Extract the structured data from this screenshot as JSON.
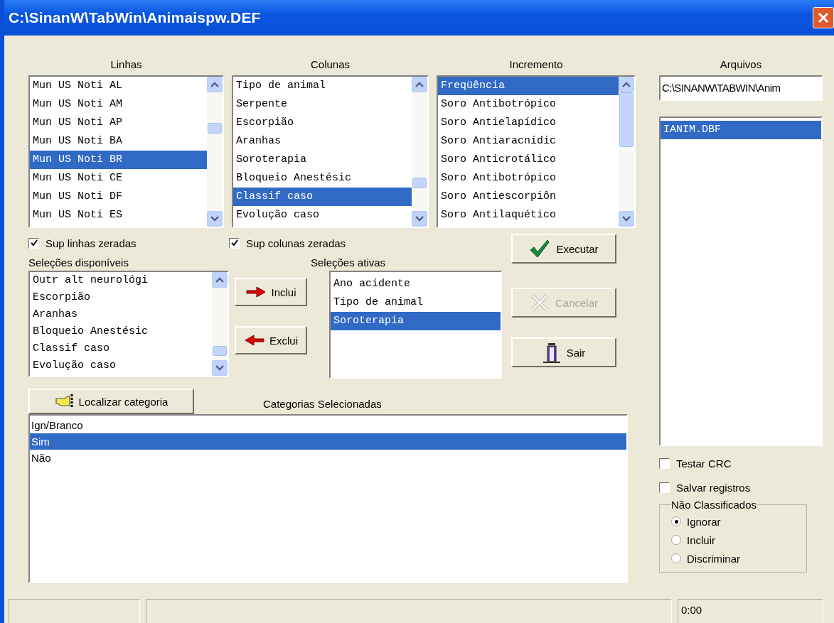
{
  "window": {
    "title": "C:\\SinanW\\TabWin\\Animaispw.DEF"
  },
  "top_lists": [
    {
      "label": "Linhas",
      "items": [
        {
          "text": "Mun US Noti AL",
          "selected": false
        },
        {
          "text": "Mun US Noti AM",
          "selected": false
        },
        {
          "text": "Mun US Noti AP",
          "selected": false
        },
        {
          "text": "Mun US Noti BA",
          "selected": false
        },
        {
          "text": "Mun US Noti BR",
          "selected": true
        },
        {
          "text": "Mun US Noti CE",
          "selected": false
        },
        {
          "text": "Mun US Noti DF",
          "selected": false
        },
        {
          "text": "Mun US Noti ES",
          "selected": false
        }
      ]
    },
    {
      "label": "Colunas",
      "items": [
        {
          "text": "Tipo de animal",
          "selected": false
        },
        {
          "text": "Serpente",
          "selected": false
        },
        {
          "text": "Escorpião",
          "selected": false
        },
        {
          "text": "Aranhas",
          "selected": false
        },
        {
          "text": "Soroterapia",
          "selected": false
        },
        {
          "text": "Bloqueio Anestésic",
          "selected": false
        },
        {
          "text": "Classif caso",
          "selected": true
        },
        {
          "text": "Evolução caso",
          "selected": false
        }
      ]
    },
    {
      "label": "Incremento",
      "items": [
        {
          "text": "Freqüência",
          "selected": true
        },
        {
          "text": "Soro Antibotrópico",
          "selected": false
        },
        {
          "text": "Soro Antielapídico",
          "selected": false
        },
        {
          "text": "Soro Antiaracnídic",
          "selected": false
        },
        {
          "text": "Soro Anticrotálico",
          "selected": false
        },
        {
          "text": "Soro Antibotrópico",
          "selected": false
        },
        {
          "text": "Soro Antiescorpiôn",
          "selected": false
        },
        {
          "text": "Soro Antilaquético",
          "selected": false
        }
      ]
    }
  ],
  "suppress": [
    {
      "label": "Sup linhas zeradas",
      "checked": true
    },
    {
      "label": "Sup colunas zeradas",
      "checked": true
    }
  ],
  "available": {
    "label": "Seleções disponíveis",
    "items": [
      {
        "text": "Outr alt neurológi",
        "selected": false
      },
      {
        "text": "Escorpião",
        "selected": false
      },
      {
        "text": "Aranhas",
        "selected": false
      },
      {
        "text": "Bloqueio Anestésic",
        "selected": false
      },
      {
        "text": "Classif caso",
        "selected": false
      },
      {
        "text": "Evolução caso",
        "selected": false
      }
    ]
  },
  "move_buttons": [
    {
      "label": "Inclui",
      "kind": "right"
    },
    {
      "label": "Exclui",
      "kind": "left"
    }
  ],
  "active": {
    "label": "Seleções ativas",
    "items": [
      {
        "text": "Ano acidente",
        "selected": false
      },
      {
        "text": "Tipo de animal",
        "selected": false
      },
      {
        "text": "Soroterapia",
        "selected": true
      }
    ]
  },
  "actions": [
    {
      "label": "Executar",
      "kind": "run",
      "disabled": false
    },
    {
      "label": "Cancelar",
      "kind": "cancel",
      "disabled": true
    },
    {
      "label": "Sair",
      "kind": "exit",
      "disabled": false
    }
  ],
  "find_button": {
    "label": "Localizar categoria"
  },
  "categories": {
    "label": "Categorias Selecionadas",
    "items": [
      {
        "text": "Ign/Branco",
        "selected": false
      },
      {
        "text": "Sim",
        "selected": true
      },
      {
        "text": "Não",
        "selected": false
      }
    ]
  },
  "files": {
    "label": "Arquivos",
    "path": "C:\\SINANW\\TABWIN\\Anim",
    "items": [
      {
        "text": "IANIM.DBF",
        "selected": true
      }
    ]
  },
  "options": [
    {
      "label": "Testar CRC",
      "checked": false
    },
    {
      "label": "Salvar registros",
      "checked": false
    }
  ],
  "unclassified": {
    "title": "Não Classificados",
    "options": [
      {
        "label": "Ignorar",
        "selected": true
      },
      {
        "label": "Incluir",
        "selected": false
      },
      {
        "label": "Discriminar",
        "selected": false
      }
    ]
  },
  "status_bar": {
    "time": "0:00"
  }
}
